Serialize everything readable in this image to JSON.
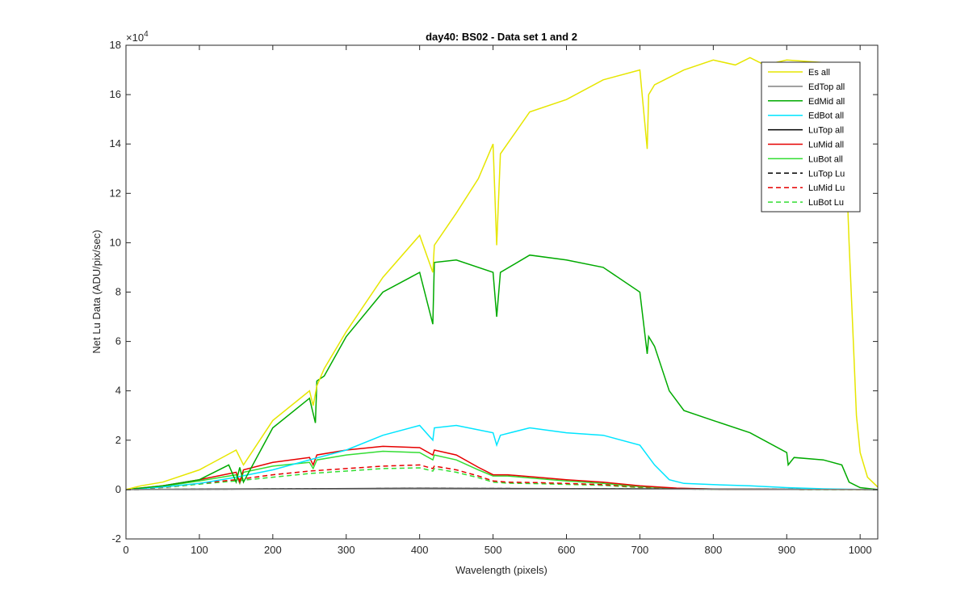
{
  "chart_data": {
    "type": "line",
    "title": "day40: BS02 - Data set 1 and 2",
    "xlabel": "Wavelength (pixels)",
    "ylabel": "Net Lu Data (ADU/pix/sec)",
    "y_exponent_label": "×10",
    "y_exponent_power": "4",
    "xlim": [
      0,
      1024
    ],
    "ylim": [
      -20000,
      180000
    ],
    "x_ticks": [
      0,
      100,
      200,
      300,
      400,
      500,
      600,
      700,
      800,
      900,
      1000
    ],
    "y_ticks": [
      -2,
      0,
      2,
      4,
      6,
      8,
      10,
      12,
      14,
      16,
      18
    ],
    "y_tick_scale": 10000,
    "grid": false,
    "legend_position": "top-right",
    "series": [
      {
        "name": "Es  all",
        "color": "#e6e600",
        "dash": "solid",
        "x": [
          0,
          20,
          50,
          100,
          150,
          160,
          200,
          250,
          255,
          260,
          270,
          300,
          350,
          400,
          418,
          420,
          450,
          480,
          500,
          505,
          510,
          550,
          600,
          650,
          700,
          710,
          712,
          720,
          760,
          800,
          830,
          850,
          870,
          900,
          950,
          975,
          980,
          985,
          990,
          995,
          1000,
          1010,
          1024
        ],
        "y": [
          0,
          1500,
          3000,
          8000,
          16000,
          10000,
          28000,
          40000,
          34000,
          42000,
          49000,
          64000,
          86000,
          103000,
          88000,
          99000,
          112000,
          126000,
          140000,
          99000,
          136000,
          153000,
          158000,
          166000,
          170000,
          138000,
          160000,
          164000,
          170000,
          174000,
          172000,
          175000,
          172000,
          174000,
          173000,
          172000,
          140000,
          100000,
          65000,
          30000,
          15000,
          5000,
          1000
        ]
      },
      {
        "name": "EdTop  all",
        "color": "#808080",
        "dash": "solid",
        "x": [
          0,
          200,
          400,
          600,
          800,
          1000,
          1024
        ],
        "y": [
          0,
          150,
          300,
          250,
          120,
          30,
          0
        ]
      },
      {
        "name": "EdMid  all",
        "color": "#00aa00",
        "dash": "solid",
        "x": [
          0,
          50,
          100,
          140,
          150,
          155,
          160,
          200,
          250,
          258,
          260,
          270,
          300,
          350,
          400,
          418,
          420,
          450,
          500,
          505,
          510,
          550,
          600,
          650,
          700,
          710,
          712,
          720,
          740,
          760,
          800,
          850,
          900,
          902,
          910,
          950,
          975,
          985,
          1000,
          1024
        ],
        "y": [
          0,
          1500,
          4000,
          10000,
          3000,
          9000,
          3000,
          25000,
          37000,
          27000,
          44000,
          46000,
          62000,
          80000,
          88000,
          67000,
          92000,
          93000,
          88000,
          70000,
          88000,
          95000,
          93000,
          90000,
          80000,
          55000,
          62000,
          58000,
          40000,
          32000,
          28000,
          23000,
          15000,
          10000,
          13000,
          12000,
          10000,
          3000,
          800,
          0
        ]
      },
      {
        "name": "EdBot  all",
        "color": "#00e5ff",
        "dash": "solid",
        "x": [
          0,
          50,
          100,
          150,
          200,
          250,
          300,
          350,
          400,
          418,
          420,
          450,
          500,
          505,
          510,
          550,
          600,
          650,
          700,
          720,
          740,
          760,
          800,
          850,
          900,
          950,
          1000,
          1024
        ],
        "y": [
          0,
          1000,
          2500,
          5000,
          8000,
          12000,
          16000,
          22000,
          26000,
          20000,
          25000,
          26000,
          23000,
          18000,
          22000,
          25000,
          23000,
          22000,
          18000,
          10000,
          4000,
          2500,
          2000,
          1500,
          800,
          300,
          50,
          0
        ]
      },
      {
        "name": "LuTop  all",
        "color": "#000000",
        "dash": "solid",
        "x": [
          0,
          200,
          400,
          600,
          800,
          1000,
          1024
        ],
        "y": [
          0,
          300,
          500,
          400,
          200,
          50,
          0
        ]
      },
      {
        "name": "LuMid  all",
        "color": "#e60000",
        "dash": "solid",
        "x": [
          0,
          50,
          100,
          150,
          155,
          160,
          200,
          250,
          255,
          260,
          300,
          350,
          400,
          418,
          420,
          450,
          480,
          500,
          520,
          560,
          600,
          650,
          700,
          750,
          800,
          900,
          1024
        ],
        "y": [
          0,
          1500,
          4000,
          7000,
          3000,
          8000,
          11000,
          13000,
          10000,
          14000,
          16000,
          17500,
          17000,
          14000,
          16000,
          14000,
          9000,
          6000,
          6000,
          5000,
          4000,
          3000,
          1500,
          600,
          200,
          50,
          0
        ]
      },
      {
        "name": "LuBot  all",
        "color": "#33dd33",
        "dash": "solid",
        "x": [
          0,
          50,
          100,
          150,
          155,
          160,
          200,
          250,
          255,
          260,
          300,
          350,
          400,
          418,
          420,
          450,
          480,
          500,
          520,
          560,
          600,
          650,
          700,
          750,
          800,
          900,
          1024
        ],
        "y": [
          0,
          1300,
          3500,
          6000,
          2500,
          7000,
          9500,
          11000,
          8500,
          12000,
          14000,
          15500,
          15000,
          12000,
          14000,
          12000,
          8000,
          5500,
          5500,
          4500,
          3500,
          2500,
          1200,
          500,
          150,
          40,
          0
        ]
      },
      {
        "name": "LuTop  Lu",
        "color": "#000000",
        "dash": "dashed",
        "x": [
          0,
          200,
          400,
          600,
          800,
          1000,
          1024
        ],
        "y": [
          0,
          250,
          450,
          350,
          150,
          40,
          0
        ]
      },
      {
        "name": "LuMid  Lu",
        "color": "#e60000",
        "dash": "dashed",
        "x": [
          0,
          50,
          100,
          150,
          200,
          250,
          300,
          350,
          400,
          418,
          420,
          450,
          480,
          500,
          520,
          560,
          600,
          650,
          700,
          750,
          800,
          900,
          1024
        ],
        "y": [
          0,
          900,
          2500,
          4000,
          6000,
          7500,
          8500,
          9500,
          10000,
          8500,
          9500,
          8000,
          5500,
          3500,
          3000,
          2800,
          2500,
          2000,
          1000,
          400,
          150,
          30,
          0
        ]
      },
      {
        "name": "LuBot  Lu",
        "color": "#33dd33",
        "dash": "dashed",
        "x": [
          0,
          50,
          100,
          150,
          200,
          250,
          300,
          350,
          400,
          418,
          420,
          450,
          480,
          500,
          520,
          560,
          600,
          650,
          700,
          750,
          800,
          900,
          1024
        ],
        "y": [
          0,
          800,
          2200,
          3500,
          5000,
          6500,
          7500,
          8500,
          8800,
          7500,
          8500,
          7000,
          4800,
          3000,
          2600,
          2400,
          2100,
          1700,
          800,
          300,
          120,
          25,
          0
        ]
      }
    ]
  }
}
